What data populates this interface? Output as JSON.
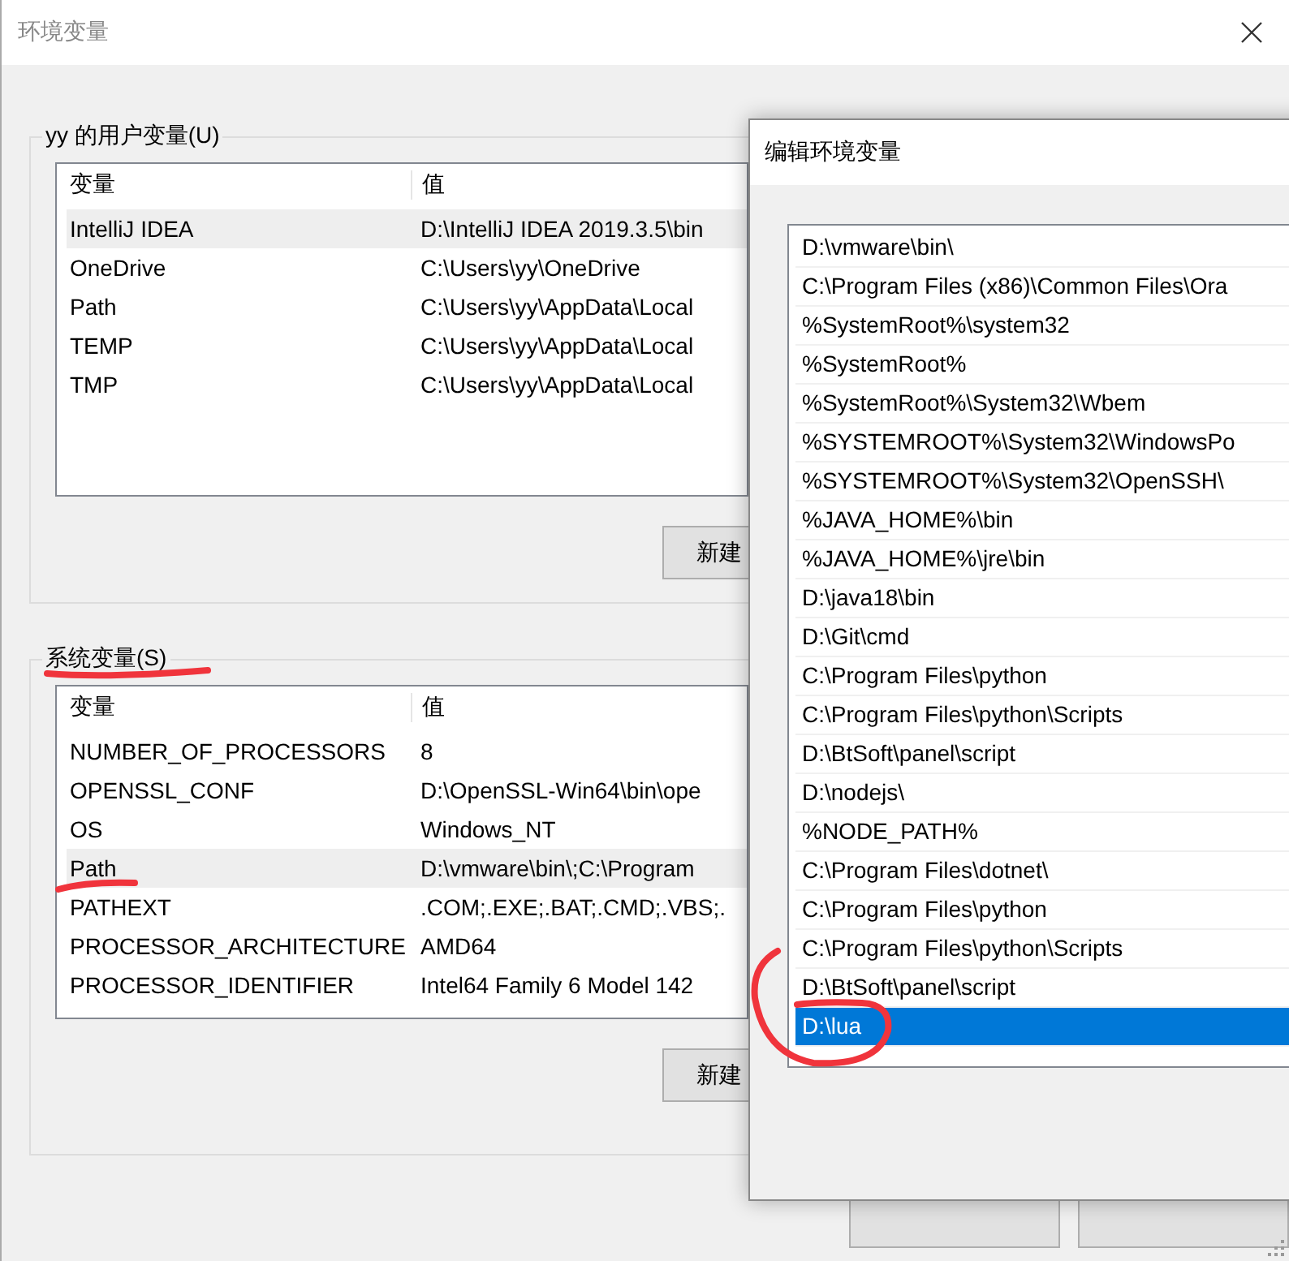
{
  "window": {
    "title": "环境变量"
  },
  "user_variables": {
    "legend": "yy 的用户变量(U)",
    "columns": [
      "变量",
      "值"
    ],
    "rows": [
      {
        "name": "IntelliJ IDEA",
        "value": "D:\\IntelliJ IDEA 2019.3.5\\bin",
        "selected": true
      },
      {
        "name": "OneDrive",
        "value": "C:\\Users\\yy\\OneDrive",
        "selected": false
      },
      {
        "name": "Path",
        "value": "C:\\Users\\yy\\AppData\\Local",
        "selected": false
      },
      {
        "name": "TEMP",
        "value": "C:\\Users\\yy\\AppData\\Local",
        "selected": false
      },
      {
        "name": "TMP",
        "value": "C:\\Users\\yy\\AppData\\Local",
        "selected": false
      }
    ],
    "button": "新建"
  },
  "system_variables": {
    "legend": "系统变量(S)",
    "columns": [
      "变量",
      "值"
    ],
    "rows": [
      {
        "name": "NUMBER_OF_PROCESSORS",
        "value": "8",
        "selected": false
      },
      {
        "name": "OPENSSL_CONF",
        "value": "D:\\OpenSSL-Win64\\bin\\ope",
        "selected": false
      },
      {
        "name": "OS",
        "value": "Windows_NT",
        "selected": false
      },
      {
        "name": "Path",
        "value": "D:\\vmware\\bin\\;C:\\Program",
        "selected": true
      },
      {
        "name": "PATHEXT",
        "value": ".COM;.EXE;.BAT;.CMD;.VBS;.",
        "selected": false
      },
      {
        "name": "PROCESSOR_ARCHITECTURE",
        "value": "AMD64",
        "selected": false
      },
      {
        "name": "PROCESSOR_IDENTIFIER",
        "value": "Intel64 Family 6 Model 142",
        "selected": false
      }
    ],
    "button": "新建"
  },
  "edit_dialog": {
    "title": "编辑环境变量",
    "entries": [
      {
        "text": "D:\\vmware\\bin\\",
        "selected": false
      },
      {
        "text": "C:\\Program Files (x86)\\Common Files\\Ora",
        "selected": false
      },
      {
        "text": "%SystemRoot%\\system32",
        "selected": false
      },
      {
        "text": "%SystemRoot%",
        "selected": false
      },
      {
        "text": "%SystemRoot%\\System32\\Wbem",
        "selected": false
      },
      {
        "text": "%SYSTEMROOT%\\System32\\WindowsPo",
        "selected": false
      },
      {
        "text": "%SYSTEMROOT%\\System32\\OpenSSH\\",
        "selected": false
      },
      {
        "text": "%JAVA_HOME%\\bin",
        "selected": false
      },
      {
        "text": "%JAVA_HOME%\\jre\\bin",
        "selected": false
      },
      {
        "text": "D:\\java18\\bin",
        "selected": false
      },
      {
        "text": "D:\\Git\\cmd",
        "selected": false
      },
      {
        "text": "C:\\Program Files\\python",
        "selected": false
      },
      {
        "text": "C:\\Program Files\\python\\Scripts",
        "selected": false
      },
      {
        "text": "D:\\BtSoft\\panel\\script",
        "selected": false
      },
      {
        "text": "D:\\nodejs\\",
        "selected": false
      },
      {
        "text": "%NODE_PATH%",
        "selected": false
      },
      {
        "text": "C:\\Program Files\\dotnet\\",
        "selected": false
      },
      {
        "text": "C:\\Program Files\\python",
        "selected": false
      },
      {
        "text": "C:\\Program Files\\python\\Scripts",
        "selected": false
      },
      {
        "text": "D:\\BtSoft\\panel\\script",
        "selected": false
      },
      {
        "text": "D:\\lua",
        "selected": true
      }
    ]
  }
}
